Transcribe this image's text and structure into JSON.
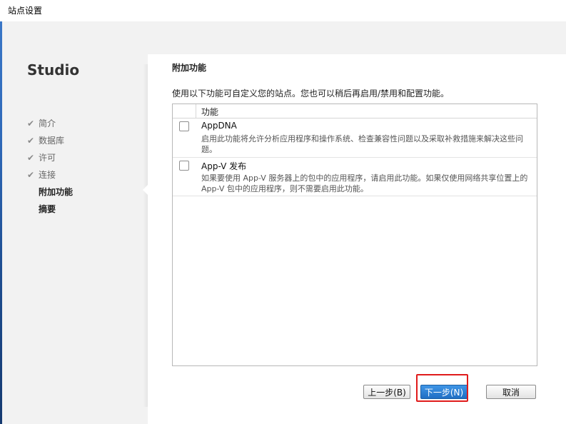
{
  "window": {
    "title": "站点设置"
  },
  "sidebar": {
    "app_title": "Studio",
    "steps": [
      {
        "label": "简介",
        "state": "done"
      },
      {
        "label": "数据库",
        "state": "done"
      },
      {
        "label": "许可",
        "state": "done"
      },
      {
        "label": "连接",
        "state": "done"
      },
      {
        "label": "附加功能",
        "state": "current"
      },
      {
        "label": "摘要",
        "state": "pending"
      }
    ]
  },
  "main": {
    "heading": "附加功能",
    "description": "使用以下功能可自定义您的站点。您也可以稍后再启用/禁用和配置功能。",
    "table": {
      "column_header": "功能",
      "rows": [
        {
          "name": "AppDNA",
          "checked": false,
          "description": "启用此功能将允许分析应用程序和操作系统、检查兼容性问题以及采取补救措施来解决这些问题。"
        },
        {
          "name": "App-V 发布",
          "checked": false,
          "description": "如果要使用 App-V 服务器上的包中的应用程序，请启用此功能。如果仅使用网络共享位置上的 App-V 包中的应用程序，则不需要启用此功能。"
        }
      ]
    }
  },
  "footer": {
    "back_label": "上一步(B)",
    "next_label": "下一步(N)",
    "cancel_label": "取消"
  },
  "colors": {
    "next_button": "#2a7fd4",
    "highlight_box": "#e01b1b"
  }
}
